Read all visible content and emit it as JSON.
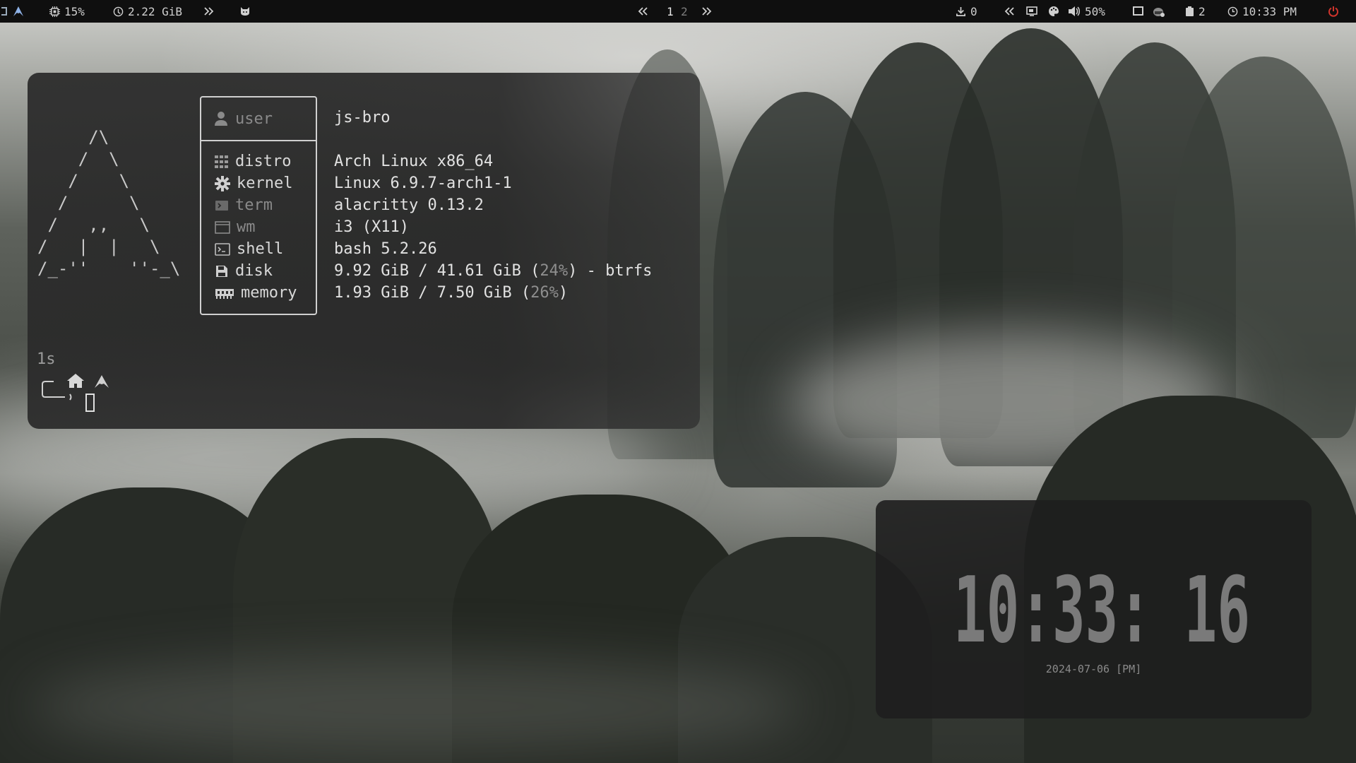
{
  "topbar": {
    "cpu": "15%",
    "memory": "2.22 GiB",
    "workspaces": [
      "1",
      "2"
    ],
    "downloads": "0",
    "volume": "50%",
    "notifications": "2",
    "time": "10:33 PM",
    "icons": [
      "arch-logo-icon",
      "cpu-icon",
      "memory-icon",
      "chevron-double-right-icon",
      "cat-icon",
      "chevron-double-left-icon",
      "chevron-double-right-icon",
      "download-icon",
      "chevron-double-left-icon",
      "display-icon",
      "palette-icon",
      "speaker-icon",
      "monitor-icon",
      "helmet-icon",
      "clipboard-icon",
      "clock-icon",
      "power-icon"
    ],
    "colors": {
      "power": "#d0342c",
      "logo": "#8fb3e8"
    }
  },
  "terminal": {
    "ascii_logo": "     /\\\n    /  \\\n   /    \\\n  /      \\\n /   ,,   \\\n/   |  |   \\\n/_-''    ''-_\\",
    "fetch": [
      {
        "label": "user",
        "value": "js-bro",
        "icon": "user-icon"
      },
      {
        "label": "distro",
        "value": "Arch Linux x86_64",
        "icon": "grid-icon"
      },
      {
        "label": "kernel",
        "value": "Linux 6.9.7-arch1-1",
        "icon": "gear-icon"
      },
      {
        "label": "term",
        "value": "alacritty 0.13.2",
        "icon": "terminal-icon"
      },
      {
        "label": "wm",
        "value": "i3 (X11)",
        "icon": "window-icon"
      },
      {
        "label": "shell",
        "value": "bash 5.2.26",
        "icon": "shell-icon"
      },
      {
        "label": "disk",
        "value": "9.92 GiB / 41.61 GiB",
        "value_pct": "24%",
        "value_suffix": " - btrfs",
        "icon": "floppy-icon"
      },
      {
        "label": "memory",
        "value": "1.93 GiB / 7.50 GiB",
        "value_pct": "26%",
        "icon": "ram-icon"
      }
    ],
    "prompt_time": "1s"
  },
  "clock": {
    "time": "10:33: 16",
    "date": "2024-07-06 [PM]"
  }
}
